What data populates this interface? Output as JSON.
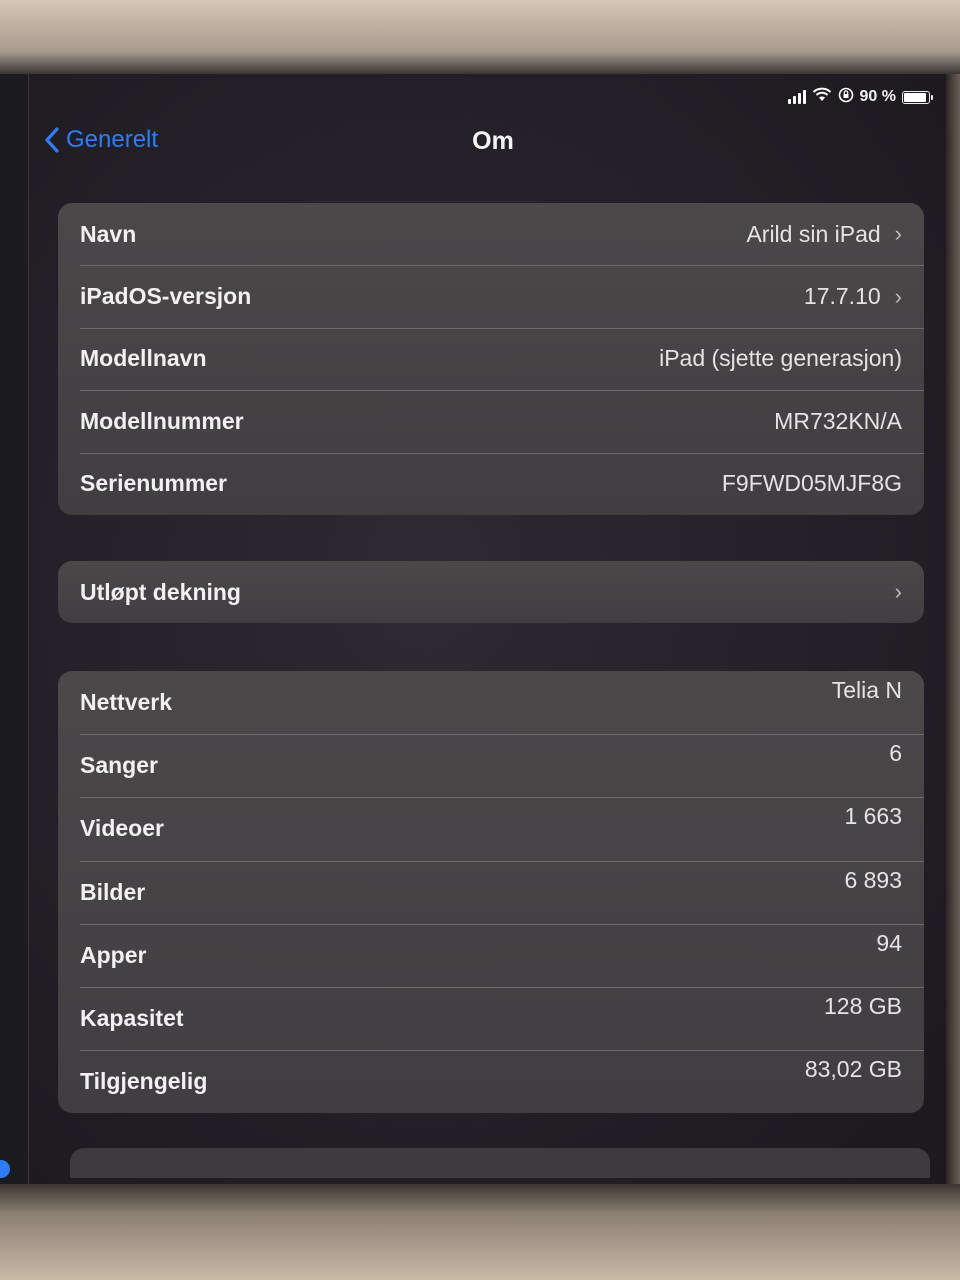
{
  "status_bar": {
    "battery_text": "90 %",
    "battery_level": 0.9,
    "icons": [
      "signal-icon",
      "wifi-icon",
      "orientation-lock-icon",
      "battery-icon"
    ]
  },
  "nav": {
    "back_label": "Generelt",
    "title": "Om"
  },
  "group_device": [
    {
      "label": "Navn",
      "value": "Arild sin iPad",
      "chevron": true
    },
    {
      "label": "iPadOS-versjon",
      "value": "17.7.10",
      "chevron": true
    },
    {
      "label": "Modellnavn",
      "value": "iPad (sjette generasjon)",
      "chevron": false
    },
    {
      "label": "Modellnummer",
      "value": "MR732KN/A",
      "chevron": false
    },
    {
      "label": "Serienummer",
      "value": "F9FWD05MJF8G",
      "chevron": false
    }
  ],
  "group_coverage": [
    {
      "label": "Utløpt dekning",
      "value": "",
      "chevron": true
    }
  ],
  "group_stats": [
    {
      "label": "Nettverk",
      "value": "Telia N"
    },
    {
      "label": "Sanger",
      "value": "6"
    },
    {
      "label": "Videoer",
      "value": "1 663"
    },
    {
      "label": "Bilder",
      "value": "6 893"
    },
    {
      "label": "Apper",
      "value": "94"
    },
    {
      "label": "Kapasitet",
      "value": "128 GB"
    },
    {
      "label": "Tilgjengelig",
      "value": "83,02 GB"
    }
  ],
  "colors": {
    "accent": "#2e7df6",
    "cell_background": "#464446",
    "screen_background": "#232127"
  }
}
